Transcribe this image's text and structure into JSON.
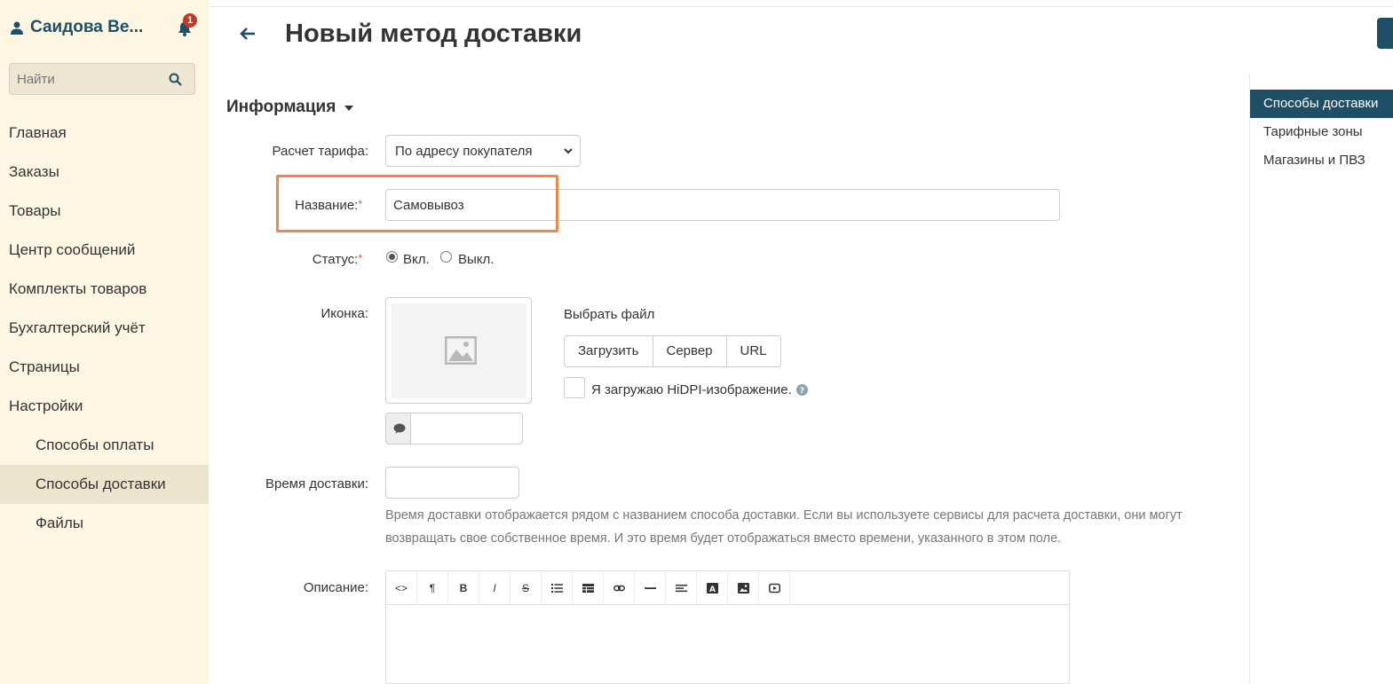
{
  "sidebar": {
    "user_name": "Саидова Ве...",
    "notification_count": "1",
    "search_placeholder": "Найти",
    "items": [
      {
        "label": "Главная",
        "sub": false,
        "active": false
      },
      {
        "label": "Заказы",
        "sub": false,
        "active": false
      },
      {
        "label": "Товары",
        "sub": false,
        "active": false
      },
      {
        "label": "Центр сообщений",
        "sub": false,
        "active": false
      },
      {
        "label": "Комплекты товаров",
        "sub": false,
        "active": false
      },
      {
        "label": "Бухгалтерский учёт",
        "sub": false,
        "active": false
      },
      {
        "label": "Страницы",
        "sub": false,
        "active": false
      },
      {
        "label": "Настройки",
        "sub": false,
        "active": false
      },
      {
        "label": "Способы оплаты",
        "sub": true,
        "active": false
      },
      {
        "label": "Способы доставки",
        "sub": true,
        "active": true
      },
      {
        "label": "Файлы",
        "sub": true,
        "active": false
      }
    ]
  },
  "header": {
    "title": "Новый метод доставки"
  },
  "right_nav": {
    "items": [
      "Способы доставки",
      "Тарифные зоны",
      "Магазины и ПВЗ"
    ]
  },
  "form": {
    "section_title": "Информация",
    "tariff": {
      "label": "Расчет тарифа:",
      "value": "По адресу покупателя"
    },
    "name": {
      "label": "Название:",
      "required_mark": "*",
      "value": "Самовывоз"
    },
    "status": {
      "label": "Статус:",
      "required_mark": "*",
      "on_label": "Вкл.",
      "off_label": "Выкл.",
      "selected": "on"
    },
    "icon": {
      "label": "Иконка:",
      "choose_file": "Выбрать файл",
      "buttons": [
        "Загрузить",
        "Сервер",
        "URL"
      ],
      "hidpi_label": "Я загружаю HiDPI-изображение."
    },
    "delivery_time": {
      "label": "Время доставки:",
      "value": "",
      "hint_line1": "Время доставки отображается рядом с названием способа доставки. Если вы используете сервисы для расчета доставки, они могут",
      "hint_line2": "возвращать свое собственное время. И это время будет отображаться вместо времени, указанного в этом поле."
    },
    "description": {
      "label": "Описание:",
      "toolbar": [
        "<>",
        "¶",
        "B",
        "I",
        "S",
        "list-icon",
        "table-icon",
        "link-icon",
        "hr-icon",
        "align-icon",
        "font-color-icon",
        "image-icon",
        "video-icon"
      ]
    }
  },
  "colors": {
    "sidebar_bg": "#fcf6e3",
    "accent": "#1f4f66",
    "highlight": "#f0874a",
    "required": "#d9534f"
  }
}
